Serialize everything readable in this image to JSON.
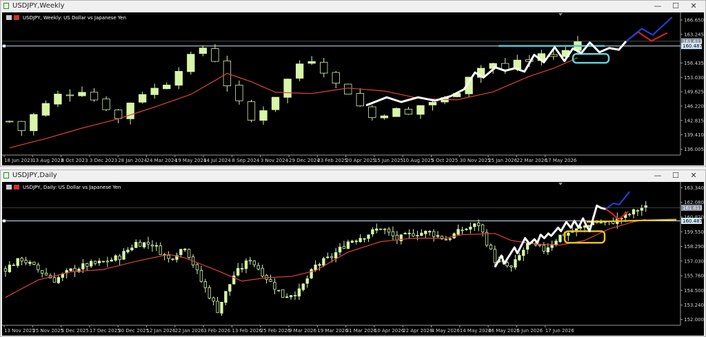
{
  "windows": [
    {
      "title": "USDJPY,Weekly",
      "info": "USDJPY, Weekly:  US Dollar vs Japanese Yen",
      "y_labels": [
        "166.650",
        "163.245",
        "160.487",
        "156.435",
        "153.030",
        "149.625",
        "146.220",
        "142.815",
        "139.410",
        "136.005"
      ],
      "x_labels": [
        "18 Jun 2023",
        "13 Aug 2023",
        "8 Oct 2023",
        "3 Dec 2023",
        "28 Jan 2024",
        "24 Mar 2024",
        "19 May 2024",
        "14 Jul 2024",
        "8 Sep 2024",
        "3 Nov 2024",
        "29 Dec 2024",
        "23 Feb 2025",
        "20 Apr 2025",
        "15 Jun 2025",
        "10 Aug 2025",
        "5 Oct 2025",
        "30 Nov 2025",
        "25 Jan 2026",
        "22 Mar 2026",
        "17 May 2026"
      ],
      "price_tag": "161.613",
      "level_tag": "160.487"
    },
    {
      "title": "USDJPY,Daily",
      "info": "USDJPY, Daily:  US Dollar vs Japanese Yen",
      "y_labels": [
        "163.340",
        "162.080",
        "160.820",
        "160.487",
        "159.550",
        "158.290",
        "157.030",
        "155.760",
        "154.500",
        "153.240",
        "152.000"
      ],
      "x_labels": [
        "13 Nov 2025",
        "25 Nov 2025",
        "5 Dec 2025",
        "17 Dec 2025",
        "30 Dec 2025",
        "12 Jan 2026",
        "22 Jan 2026",
        "3 Feb 2026",
        "13 Feb 2026",
        "25 Feb 2026",
        "9 Mar 2026",
        "19 Mar 2026",
        "31 Mar 2026",
        "10 Apr 2026",
        "22 Apr 2026",
        "4 May 2026",
        "14 May 2026",
        "26 May 2026",
        "5 Jun 2026",
        "17 Jun 2026"
      ],
      "price_tag": "161.613",
      "level_tag": "160.487"
    }
  ],
  "controls": {
    "minimize": "—",
    "maximize": "☐",
    "close": "✕"
  },
  "colors": {
    "candle": "#d8f5a8",
    "moving_average": "#e0443a",
    "level_line": "#cfe8ff",
    "projection_up": "#1f3fd9",
    "projection_down": "#d42020",
    "trend_path": "#ffffff",
    "weekly_box": "#5fd3e0",
    "daily_box": "#e8c21e",
    "weekly_zone_line": "#4fc9d9",
    "daily_zone_line": "#e8c21e"
  },
  "chart_data": [
    {
      "type": "candlestick",
      "symbol": "USDJPY",
      "timeframe": "Weekly",
      "ylim": [
        134.6,
        167.8
      ],
      "x_ticks": [
        "18 Jun 2023",
        "13 Aug 2023",
        "8 Oct 2023",
        "3 Dec 2023",
        "28 Jan 2024",
        "24 Mar 2024",
        "19 May 2024",
        "14 Jul 2024",
        "8 Sep 2024",
        "3 Nov 2024",
        "29 Dec 2024",
        "23 Feb 2025",
        "20 Apr 2025",
        "15 Jun 2025",
        "10 Aug 2025",
        "5 Oct 2025",
        "30 Nov 2025",
        "25 Jan 2026",
        "22 Mar 2026",
        "17 May 2026"
      ],
      "close_path": [
        [
          0,
          142.6
        ],
        [
          1,
          140.5
        ],
        [
          2,
          144.1
        ],
        [
          3,
          146.6
        ],
        [
          4,
          148.8
        ],
        [
          5,
          149.2
        ],
        [
          6,
          150.1
        ],
        [
          7,
          147.8
        ],
        [
          8,
          145.9
        ],
        [
          9,
          143.2
        ],
        [
          10,
          147.2
        ],
        [
          11,
          149.4
        ],
        [
          12,
          150.3
        ],
        [
          13,
          151.8
        ],
        [
          14,
          155.2
        ],
        [
          15,
          157.8
        ],
        [
          16,
          160.1
        ],
        [
          17,
          157.2
        ],
        [
          18,
          151.4
        ],
        [
          19,
          146.8
        ],
        [
          20,
          142.8
        ],
        [
          21,
          145.6
        ],
        [
          22,
          148.7
        ],
        [
          23,
          152.5
        ],
        [
          24,
          156.3
        ],
        [
          25,
          157.4
        ],
        [
          26,
          154.8
        ],
        [
          27,
          151.4
        ],
        [
          28,
          149.6
        ],
        [
          29,
          146.2
        ],
        [
          30,
          143.5
        ],
        [
          31,
          144.6
        ],
        [
          32,
          145.2
        ],
        [
          33,
          144.1
        ],
        [
          34,
          146.4
        ],
        [
          35,
          147.2
        ],
        [
          36,
          147.9
        ],
        [
          37,
          149.9
        ],
        [
          38,
          153.6
        ],
        [
          39,
          155.3
        ],
        [
          40,
          156.3
        ],
        [
          41,
          154.6
        ],
        [
          42,
          157.2
        ],
        [
          43,
          156.8
        ],
        [
          44,
          158.6
        ],
        [
          45,
          158.1
        ],
        [
          46,
          159.2
        ],
        [
          47,
          161.6
        ]
      ],
      "moving_average": [
        [
          0,
          136.3
        ],
        [
          3,
          138.5
        ],
        [
          6,
          141.0
        ],
        [
          9,
          143.2
        ],
        [
          12,
          146.0
        ],
        [
          15,
          149.0
        ],
        [
          17,
          152.3
        ],
        [
          18,
          154.0
        ],
        [
          20,
          152.0
        ],
        [
          22,
          149.5
        ],
        [
          25,
          149.2
        ],
        [
          28,
          150.5
        ],
        [
          31,
          149.8
        ],
        [
          34,
          148.0
        ],
        [
          37,
          147.7
        ],
        [
          40,
          149.6
        ],
        [
          43,
          153.3
        ],
        [
          45,
          155.2
        ],
        [
          47,
          157.7
        ],
        [
          48,
          158.2
        ]
      ],
      "trend_path": [
        [
          29.5,
          146.4
        ],
        [
          31.2,
          148.3
        ],
        [
          32.4,
          147.2
        ],
        [
          33.8,
          148.3
        ],
        [
          35.2,
          147.5
        ],
        [
          36.5,
          148.6
        ],
        [
          37.6,
          150.2
        ],
        [
          38.5,
          154.2
        ],
        [
          39.2,
          153.0
        ],
        [
          40.2,
          155.4
        ],
        [
          41.0,
          154.6
        ],
        [
          41.8,
          155.2
        ],
        [
          42.6,
          154.4
        ],
        [
          43.4,
          158.4
        ],
        [
          44.2,
          156.6
        ],
        [
          45.1,
          160.2
        ],
        [
          45.9,
          156.9
        ],
        [
          46.6,
          159.9
        ],
        [
          47.3,
          158.8
        ],
        [
          48.0,
          161.3
        ],
        [
          48.8,
          159.0
        ],
        [
          49.6,
          160.0
        ],
        [
          50.4,
          159.6
        ],
        [
          51.0,
          161.6
        ]
      ],
      "projection_up": [
        [
          51.0,
          161.6
        ],
        [
          52.3,
          164.6
        ],
        [
          53.2,
          163.1
        ],
        [
          54.8,
          167.3
        ]
      ],
      "projection_down": [
        [
          51.0,
          161.6
        ],
        [
          52.0,
          163.8
        ],
        [
          53.1,
          161.7
        ],
        [
          54.4,
          163.6
        ]
      ],
      "level": 160.487,
      "last_price": 161.613,
      "zone_line": 160.5,
      "zone_box": [
        156.5,
        158.6
      ]
    },
    {
      "type": "candlestick",
      "symbol": "USDJPY",
      "timeframe": "Daily",
      "ylim": [
        151.5,
        163.6
      ],
      "x_ticks": [
        "13 Nov 2025",
        "25 Nov 2025",
        "5 Dec 2025",
        "17 Dec 2025",
        "30 Dec 2025",
        "12 Jan 2026",
        "22 Jan 2026",
        "3 Feb 2026",
        "13 Feb 2026",
        "25 Feb 2026",
        "9 Mar 2026",
        "19 Mar 2026",
        "31 Mar 2026",
        "10 Apr 2026",
        "22 Apr 2026",
        "4 May 2026",
        "14 May 2026",
        "26 May 2026",
        "5 Jun 2026",
        "17 Jun 2026"
      ],
      "close_path": [
        [
          0,
          156.4
        ],
        [
          4,
          157.2
        ],
        [
          8,
          156.3
        ],
        [
          12,
          155.4
        ],
        [
          16,
          156.2
        ],
        [
          20,
          156.7
        ],
        [
          24,
          156.9
        ],
        [
          28,
          157.4
        ],
        [
          32,
          158.6
        ],
        [
          36,
          158.5
        ],
        [
          40,
          157.2
        ],
        [
          44,
          158.3
        ],
        [
          48,
          155.3
        ],
        [
          52,
          152.8
        ],
        [
          56,
          155.8
        ],
        [
          60,
          157.2
        ],
        [
          64,
          155.6
        ],
        [
          68,
          154.0
        ],
        [
          72,
          154.4
        ],
        [
          76,
          156.6
        ],
        [
          80,
          157.4
        ],
        [
          84,
          158.7
        ],
        [
          88,
          159.2
        ],
        [
          92,
          159.9
        ],
        [
          96,
          158.9
        ],
        [
          100,
          159.4
        ],
        [
          104,
          159.5
        ],
        [
          108,
          158.9
        ],
        [
          112,
          159.7
        ],
        [
          116,
          160.2
        ],
        [
          120,
          157.1
        ],
        [
          124,
          156.4
        ],
        [
          128,
          158.5
        ],
        [
          132,
          158.0
        ],
        [
          136,
          159.2
        ],
        [
          140,
          159.7
        ],
        [
          144,
          160.4
        ],
        [
          148,
          160.3
        ],
        [
          152,
          160.9
        ],
        [
          156,
          161.6
        ]
      ],
      "moving_average": [
        [
          0,
          153.9
        ],
        [
          8,
          155.4
        ],
        [
          16,
          156.1
        ],
        [
          24,
          156.3
        ],
        [
          32,
          157.0
        ],
        [
          40,
          157.6
        ],
        [
          44,
          157.3
        ],
        [
          52,
          156.2
        ],
        [
          58,
          155.3
        ],
        [
          64,
          155.6
        ],
        [
          70,
          155.7
        ],
        [
          76,
          156.2
        ],
        [
          84,
          157.8
        ],
        [
          92,
          158.7
        ],
        [
          100,
          159.0
        ],
        [
          108,
          159.0
        ],
        [
          112,
          159.3
        ],
        [
          120,
          159.4
        ],
        [
          124,
          158.8
        ],
        [
          130,
          158.5
        ],
        [
          136,
          158.4
        ],
        [
          142,
          158.8
        ],
        [
          148,
          159.8
        ],
        [
          154,
          160.4
        ],
        [
          158,
          160.7
        ]
      ],
      "trend_path": [
        [
          120,
          156.5
        ],
        [
          121.6,
          157.5
        ],
        [
          122.3,
          156.8
        ],
        [
          124.8,
          158.2
        ],
        [
          125.5,
          157.7
        ],
        [
          127.4,
          159.0
        ],
        [
          128.5,
          158.5
        ],
        [
          129.7,
          158.9
        ],
        [
          130.4,
          158.6
        ],
        [
          131.2,
          159.3
        ],
        [
          132.1,
          159.0
        ],
        [
          133.1,
          159.4
        ],
        [
          133.8,
          159.2
        ],
        [
          135.5,
          159.9
        ],
        [
          136.2,
          159.6
        ],
        [
          137.5,
          160.4
        ],
        [
          138.6,
          159.9
        ],
        [
          139.5,
          160.5
        ],
        [
          140.5,
          159.9
        ],
        [
          141.6,
          160.7
        ],
        [
          142.4,
          160.1
        ],
        [
          143.2,
          159.6
        ],
        [
          145.0,
          161.8
        ],
        [
          146.0,
          161.6
        ],
        [
          147.2,
          161.5
        ]
      ],
      "projection_up": [
        [
          147.2,
          161.5
        ],
        [
          149.0,
          162.0
        ],
        [
          150.5,
          161.9
        ],
        [
          153.0,
          163.0
        ]
      ],
      "projection_down": [
        [
          147.2,
          161.5
        ],
        [
          148.8,
          161.1
        ],
        [
          150.3,
          160.6
        ],
        [
          152.7,
          161.3
        ]
      ],
      "level": 160.487,
      "last_price": 161.613,
      "zone_line": [
        [
          142.5,
          160.4
        ],
        [
          164.5,
          160.6
        ]
      ],
      "zone_box": [
        158.6,
        159.6
      ]
    }
  ]
}
